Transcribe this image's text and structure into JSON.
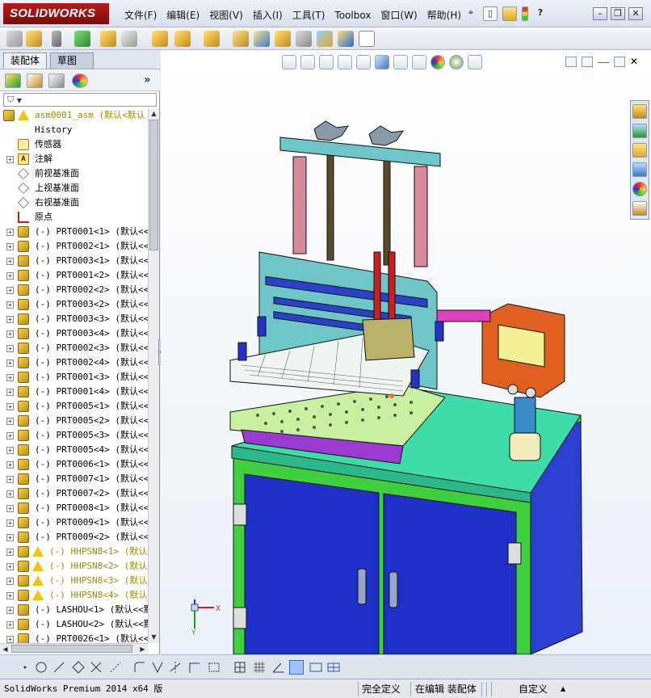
{
  "app": {
    "logo_text": "SOLIDWORKS"
  },
  "menu": [
    "文件(F)",
    "编辑(E)",
    "视图(V)",
    "插入(I)",
    "工具(T)",
    "Toolbox",
    "窗口(W)",
    "帮助(H)"
  ],
  "title_tools": {
    "help_label": "?"
  },
  "window_controls": {
    "minimize": "–",
    "restore": "❐",
    "close": "✕"
  },
  "panel": {
    "tabs": [
      "装配体",
      "草图"
    ],
    "active_tab": 0,
    "expand_label": "»",
    "filter_glyph": "▼"
  },
  "tree": [
    {
      "label": "asm0001_asm  (默认<默认",
      "icon": "assembly",
      "warn": true,
      "highlight": true,
      "level": 0,
      "expander": false
    },
    {
      "label": "History",
      "icon": "history",
      "level": 1,
      "expander": false
    },
    {
      "label": "传感器",
      "icon": "sensor",
      "level": 1,
      "expander": false
    },
    {
      "label": "注解",
      "icon": "note",
      "level": 1,
      "expander": true
    },
    {
      "label": "前视基准面",
      "icon": "plane",
      "level": 1,
      "expander": false
    },
    {
      "label": "上视基准面",
      "icon": "plane",
      "level": 1,
      "expander": false
    },
    {
      "label": "右视基准面",
      "icon": "plane",
      "level": 1,
      "expander": false
    },
    {
      "label": "原点",
      "icon": "origin",
      "level": 1,
      "expander": false
    },
    {
      "label": "(-) PRT0001<1> (默认<<默",
      "icon": "part",
      "level": 1,
      "expander": true
    },
    {
      "label": "(-) PRT0002<1> (默认<<默",
      "icon": "part",
      "level": 1,
      "expander": true
    },
    {
      "label": "(-) PRT0003<1> (默认<<默",
      "icon": "part",
      "level": 1,
      "expander": true
    },
    {
      "label": "(-) PRT0001<2> (默认<<默",
      "icon": "part",
      "level": 1,
      "expander": true
    },
    {
      "label": "(-) PRT0002<2> (默认<<默",
      "icon": "part",
      "level": 1,
      "expander": true
    },
    {
      "label": "(-) PRT0003<2> (默认<<默",
      "icon": "part",
      "level": 1,
      "expander": true
    },
    {
      "label": "(-) PRT0003<3> (默认<<默",
      "icon": "part",
      "level": 1,
      "expander": true
    },
    {
      "label": "(-) PRT0003<4> (默认<<默",
      "icon": "part",
      "level": 1,
      "expander": true
    },
    {
      "label": "(-) PRT0002<3> (默认<<默",
      "icon": "part",
      "level": 1,
      "expander": true
    },
    {
      "label": "(-) PRT0002<4> (默认<<默",
      "icon": "part",
      "level": 1,
      "expander": true
    },
    {
      "label": "(-) PRT0001<3> (默认<<默",
      "icon": "part",
      "level": 1,
      "expander": true
    },
    {
      "label": "(-) PRT0001<4> (默认<<默",
      "icon": "part",
      "level": 1,
      "expander": true
    },
    {
      "label": "(-) PRT0005<1> (默认<<默",
      "icon": "part",
      "level": 1,
      "expander": true
    },
    {
      "label": "(-) PRT0005<2> (默认<<默",
      "icon": "part",
      "level": 1,
      "expander": true
    },
    {
      "label": "(-) PRT0005<3> (默认<<默",
      "icon": "part",
      "level": 1,
      "expander": true
    },
    {
      "label": "(-) PRT0005<4> (默认<<默",
      "icon": "part",
      "level": 1,
      "expander": true
    },
    {
      "label": "(-) PRT0006<1> (默认<<默",
      "icon": "part",
      "level": 1,
      "expander": true
    },
    {
      "label": "(-) PRT0007<1> (默认<<默",
      "icon": "part",
      "level": 1,
      "expander": true
    },
    {
      "label": "(-) PRT0007<2> (默认<<默",
      "icon": "part",
      "level": 1,
      "expander": true
    },
    {
      "label": "(-) PRT0008<1> (默认<<默",
      "icon": "part",
      "level": 1,
      "expander": true
    },
    {
      "label": "(-) PRT0009<1> (默认<<默",
      "icon": "part",
      "level": 1,
      "expander": true
    },
    {
      "label": "(-) PRT0009<2> (默认<<默",
      "icon": "part",
      "level": 1,
      "expander": true
    },
    {
      "label": "(-) HHPSN8<1> (默认<",
      "icon": "part",
      "warn": true,
      "highlight": true,
      "level": 1,
      "expander": true
    },
    {
      "label": "(-) HHPSN8<2> (默认<",
      "icon": "part",
      "warn": true,
      "highlight": true,
      "level": 1,
      "expander": true
    },
    {
      "label": "(-) HHPSN8<3> (默认<",
      "icon": "part",
      "warn": true,
      "highlight": true,
      "level": 1,
      "expander": true
    },
    {
      "label": "(-) HHPSN8<4> (默认<",
      "icon": "part",
      "warn": true,
      "highlight": true,
      "level": 1,
      "expander": true
    },
    {
      "label": "(-) LASHOU<1> (默认<<默",
      "icon": "part",
      "level": 1,
      "expander": true
    },
    {
      "label": "(-) LASHOU<2> (默认<<默",
      "icon": "part",
      "level": 1,
      "expander": true
    },
    {
      "label": "(-) PRT0026<1> (默认<<默",
      "icon": "part",
      "level": 1,
      "expander": true
    }
  ],
  "triad": {
    "x": "X",
    "y": "Y"
  },
  "status": {
    "product": "SolidWorks Premium 2014 x64 版",
    "definition": "完全定义",
    "mode": "在编辑 装配体",
    "units": "自定义",
    "units_arrow": "▲"
  },
  "colors": {
    "cabinet_frame": "#3fcf3f",
    "cabinet_door": "#2233cc",
    "table_top": "#3ddca8",
    "plate": "#c9f0a0",
    "gantry": "#6fc6c9",
    "column": "#d88a9a",
    "control_box": "#e06020",
    "screen": "#f4f094",
    "pipe": "#e040c0",
    "logo_bg": "#9b1313"
  }
}
